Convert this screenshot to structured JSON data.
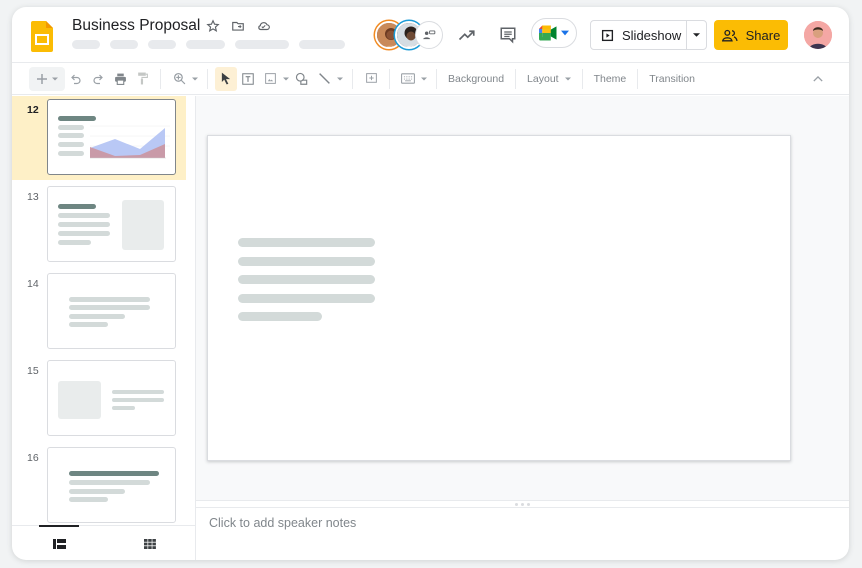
{
  "app": {
    "title": "Business Proposal",
    "brand_color": "#fbbc04"
  },
  "header": {
    "title_icons": [
      "star-icon",
      "move-to-folder-icon",
      "cloud-saved-icon"
    ],
    "menu_placeholder_count": 6,
    "collaborators": [
      "collaborator-avatar-1",
      "collaborator-avatar-2",
      "present-to-meeting-icon"
    ],
    "activity_icon": "trending-up-icon",
    "comments_icon": "comment-icon",
    "meet_icon": "google-meet-icon",
    "slideshow_label": "Slideshow",
    "share_label": "Share"
  },
  "toolbar": {
    "icons": [
      "new-slide-icon",
      "undo-icon",
      "redo-icon",
      "print-icon",
      "paint-format-icon",
      "zoom-icon",
      "select-icon",
      "text-box-icon",
      "image-icon",
      "shape-icon",
      "line-icon",
      "comment-add-icon",
      "input-tools-icon"
    ],
    "background_label": "Background",
    "layout_label": "Layout",
    "theme_label": "Theme",
    "transition_label": "Transition"
  },
  "filmstrip": {
    "slides": [
      {
        "number": "12",
        "selected": true,
        "layout": "chart"
      },
      {
        "number": "13",
        "selected": false,
        "layout": "text-image"
      },
      {
        "number": "14",
        "selected": false,
        "layout": "text-centered"
      },
      {
        "number": "15",
        "selected": false,
        "layout": "image-text"
      },
      {
        "number": "16",
        "selected": false,
        "layout": "title-text"
      }
    ],
    "view_tabs": [
      "filmstrip-view",
      "grid-view"
    ],
    "active_view": "filmstrip-view"
  },
  "notes": {
    "placeholder": "Click to add speaker notes"
  }
}
